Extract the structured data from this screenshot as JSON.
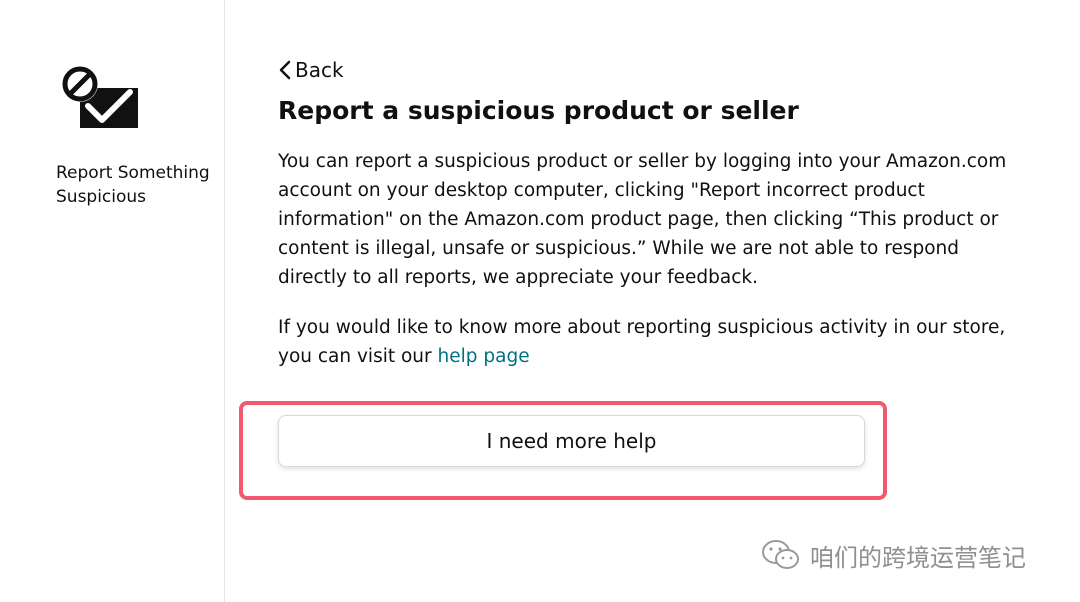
{
  "sidebar": {
    "icon": "prohibited-envelope-icon",
    "label": "Report Something Suspicious"
  },
  "main": {
    "back_label": "Back",
    "title": "Report a suspicious product or seller",
    "paragraph1": "You can report a suspicious product or seller by logging into your Amazon.com account on your desktop computer, clicking \"Report incorrect product information\" on the Amazon.com product page, then clicking “This product or content is illegal, unsafe or suspicious.” While we are not able to respond directly to all reports, we appreciate your feedback.",
    "paragraph2_prefix": "If you would like to know more about reporting suspicious activity in our store, you can visit our",
    "help_link": "help page",
    "button_label": "I need more help"
  },
  "colors": {
    "link": "#007185",
    "highlight": "#f05a6c",
    "divider": "#e3e6e6"
  },
  "watermark": {
    "icon": "wechat-icon",
    "text": "咱们的跨境运营笔记"
  }
}
